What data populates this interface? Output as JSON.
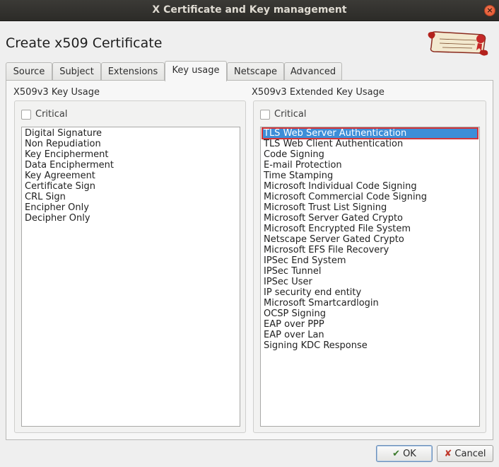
{
  "window": {
    "title": "X Certificate and Key management"
  },
  "dialog": {
    "heading": "Create x509 Certificate"
  },
  "tabs": [
    {
      "label": "Source"
    },
    {
      "label": "Subject"
    },
    {
      "label": "Extensions"
    },
    {
      "label": "Key usage",
      "active": true
    },
    {
      "label": "Netscape"
    },
    {
      "label": "Advanced"
    }
  ],
  "key_usage": {
    "title": "X509v3 Key Usage",
    "critical_label": "Critical",
    "critical_checked": false,
    "items": [
      "Digital Signature",
      "Non Repudiation",
      "Key Encipherment",
      "Data Encipherment",
      "Key Agreement",
      "Certificate Sign",
      "CRL Sign",
      "Encipher Only",
      "Decipher Only"
    ]
  },
  "extended_key_usage": {
    "title": "X509v3 Extended Key Usage",
    "critical_label": "Critical",
    "critical_checked": false,
    "selected_index": 0,
    "items": [
      "TLS Web Server Authentication",
      "TLS Web Client Authentication",
      "Code Signing",
      "E-mail Protection",
      "Time Stamping",
      "Microsoft Individual Code Signing",
      "Microsoft Commercial Code Signing",
      "Microsoft Trust List Signing",
      "Microsoft Server Gated Crypto",
      "Microsoft Encrypted File System",
      "Netscape Server Gated Crypto",
      "Microsoft EFS File Recovery",
      "IPSec End System",
      "IPSec Tunnel",
      "IPSec User",
      "IP security end entity",
      "Microsoft Smartcardlogin",
      "OCSP Signing",
      "EAP over PPP",
      "EAP over Lan",
      "Signing KDC Response"
    ]
  },
  "buttons": {
    "ok": "OK",
    "cancel": "Cancel"
  },
  "colors": {
    "selection": "#3d8ed8",
    "selection_outline": "#d2353a",
    "titlebar": "#2f2e2b"
  }
}
